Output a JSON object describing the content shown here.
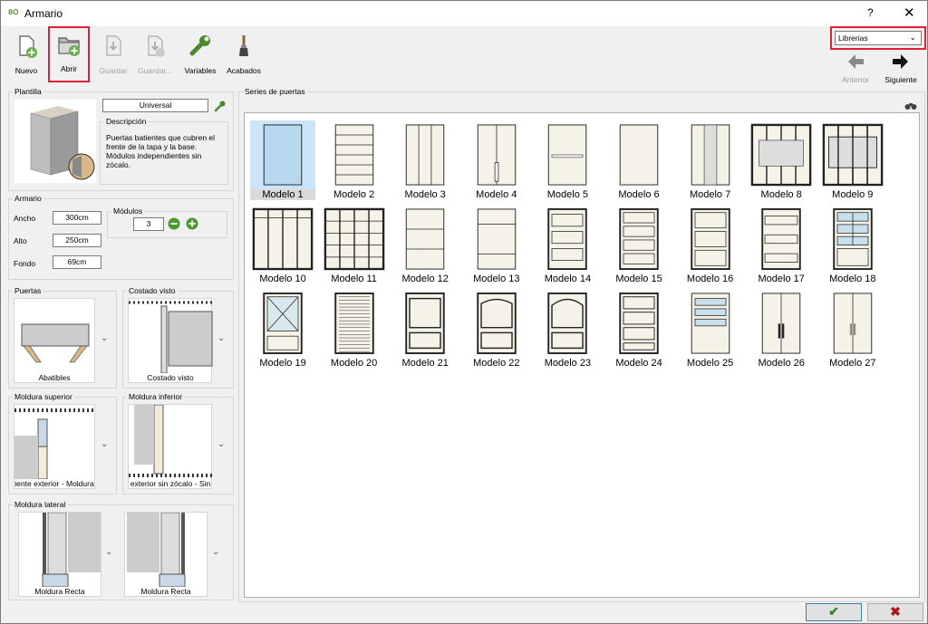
{
  "window": {
    "title": "Armario",
    "help": "?",
    "close": "✕"
  },
  "toolbar": {
    "nuevo": "Nuevo",
    "abrir": "Abrir",
    "guardar": "Guardar",
    "guardar_como": "Guardar...",
    "variables": "Variables",
    "acabados": "Acabados"
  },
  "library": {
    "selected": "Librerias"
  },
  "nav": {
    "anterior": "Anterior",
    "siguiente": "Siguiente"
  },
  "plantilla": {
    "title": "Plantilla",
    "template_name": "Universal",
    "descripcion_title": "Descripción",
    "descripcion": "Puertas batientes que cubren el frente de la tapa y la base. Módulos independientes sin zócalo."
  },
  "armario": {
    "title": "Armario",
    "ancho_label": "Ancho",
    "ancho": "300cm",
    "alto_label": "Alto",
    "alto": "250cm",
    "fondo_label": "Fondo",
    "fondo": "69cm",
    "modulos_label": "Módulos",
    "modulos": "3"
  },
  "puertas": {
    "title": "Puertas",
    "value": "Abatibles"
  },
  "costado": {
    "title": "Costado visto",
    "value": "Costado visto"
  },
  "moldura_superior": {
    "title": "Moldura superior",
    "value": "iente exterior - Moldura"
  },
  "moldura_inferior": {
    "title": "Moldura inferior",
    "value": "exterior sin zócalo - Sin"
  },
  "moldura_lateral": {
    "title": "Moldura lateral",
    "left": "Moldura Recta",
    "right": "Moldura Recta"
  },
  "series": {
    "title": "Series de puertas",
    "models": [
      "Modelo 1",
      "Modelo 2",
      "Modelo 3",
      "Modelo 4",
      "Modelo 5",
      "Modelo 6",
      "Modelo 7",
      "Modelo 8",
      "Modelo 9",
      "Modelo 10",
      "Modelo 11",
      "Modelo 12",
      "Modelo 13",
      "Modelo 14",
      "Modelo 15",
      "Modelo 16",
      "Modelo 17",
      "Modelo 18",
      "Modelo 19",
      "Modelo 20",
      "Modelo 21",
      "Modelo 22",
      "Modelo 23",
      "Modelo 24",
      "Modelo 25",
      "Modelo 26",
      "Modelo 27"
    ],
    "selected": "Modelo 1"
  },
  "buttons": {
    "ok": "✔",
    "cancel": "✖"
  },
  "colors": {
    "highlight": "#e0203a",
    "ok": "#2a8a2a",
    "cancel": "#b01818",
    "selection": "#cce4f7"
  }
}
